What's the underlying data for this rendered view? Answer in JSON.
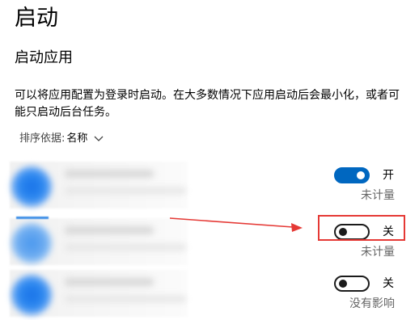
{
  "page": {
    "title": "启动",
    "subtitle": "启动应用",
    "description": "可以将应用配置为登录时启动。在大多数情况下应用启动后会最小化，或者可能只启动后台任务。"
  },
  "sort": {
    "label": "排序依据:",
    "value": "名称",
    "icon": "chevron-down-icon"
  },
  "apps": [
    {
      "state_on": true,
      "toggle_label": "开",
      "impact": "未计量"
    },
    {
      "state_on": false,
      "toggle_label": "关",
      "impact": "未计量"
    },
    {
      "state_on": false,
      "toggle_label": "关",
      "impact": "没有影响"
    }
  ],
  "annotation": {
    "highlight_color": "#e53935",
    "target_row": 2
  },
  "colors": {
    "accent": "#0067c0",
    "toggle_off_border": "#1b1b1b",
    "secondary_text": "#666666"
  }
}
